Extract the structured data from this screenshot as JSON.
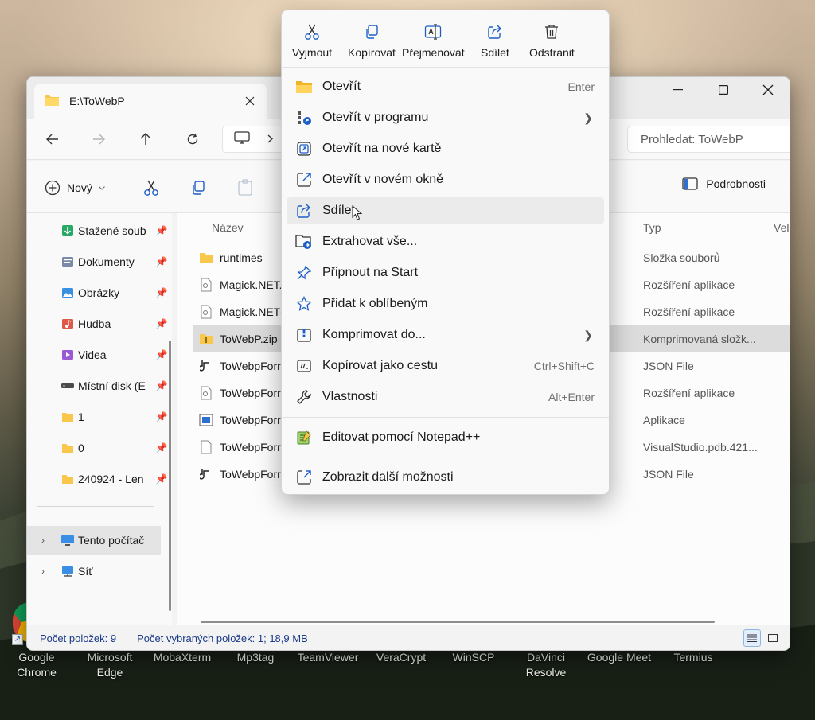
{
  "desktop": {
    "icons": [
      {
        "label": "Google\nChrome"
      },
      {
        "label": "Microsoft\nEdge"
      },
      {
        "label": "MobaXterm"
      },
      {
        "label": "Mp3tag"
      },
      {
        "label": "TeamViewer"
      },
      {
        "label": "VeraCrypt"
      },
      {
        "label": "WinSCP"
      },
      {
        "label": "DaVinci\nResolve"
      },
      {
        "label": "Google Meet"
      },
      {
        "label": "Termius"
      }
    ]
  },
  "window": {
    "tab_title": "E:\\ToWebP",
    "search_placeholder": "Prohledat: ToWebP",
    "commandbar": {
      "new_label": "Nový",
      "details_label": "Podrobnosti"
    },
    "sidebar": {
      "items": [
        {
          "label": "Stažené soub",
          "icon": "download-icon",
          "pinned": true
        },
        {
          "label": "Dokumenty",
          "icon": "documents-icon",
          "pinned": true
        },
        {
          "label": "Obrázky",
          "icon": "pictures-icon",
          "pinned": true
        },
        {
          "label": "Hudba",
          "icon": "music-icon",
          "pinned": true
        },
        {
          "label": "Videa",
          "icon": "videos-icon",
          "pinned": true
        },
        {
          "label": "Místní disk (E",
          "icon": "drive-icon",
          "pinned": true
        },
        {
          "label": "1",
          "icon": "folder-icon",
          "pinned": true
        },
        {
          "label": "0",
          "icon": "folder-icon",
          "pinned": true
        },
        {
          "label": "240924 - Len",
          "icon": "folder-icon",
          "pinned": true
        }
      ],
      "this_pc": "Tento počítač",
      "network": "Síť"
    },
    "columns": {
      "name": "Název",
      "type": "Typ",
      "size": "Veli"
    },
    "files": [
      {
        "name": "runtimes",
        "type": "Složka souborů",
        "icon": "folder-icon"
      },
      {
        "name": "Magick.NET.",
        "type": "Rozšíření aplikace",
        "icon": "dll-icon"
      },
      {
        "name": "Magick.NET-",
        "type": "Rozšíření aplikace",
        "icon": "dll-icon"
      },
      {
        "name": "ToWebP.zip",
        "type": "Komprimovaná složk...",
        "icon": "zip-folder-icon",
        "selected": true
      },
      {
        "name": "ToWebpForr",
        "type": "JSON File",
        "icon": "json-icon"
      },
      {
        "name": "ToWebpForr",
        "type": "Rozšíření aplikace",
        "icon": "dll-icon"
      },
      {
        "name": "ToWebpForr",
        "type": "Aplikace",
        "icon": "app-icon"
      },
      {
        "name": "ToWebpForr",
        "type": "VisualStudio.pdb.421...",
        "icon": "file-icon"
      },
      {
        "name": "ToWebpForr",
        "type": "JSON File",
        "icon": "json-icon"
      }
    ],
    "status": {
      "count": "Počet položek: 9",
      "selected": "Počet vybraných položek: 1; 18,9 MB"
    }
  },
  "context_menu": {
    "actions": [
      {
        "label": "Vyjmout",
        "icon": "cut-icon"
      },
      {
        "label": "Kopírovat",
        "icon": "copy-icon"
      },
      {
        "label": "Přejmenovat",
        "icon": "rename-icon"
      },
      {
        "label": "Sdílet",
        "icon": "share-icon"
      },
      {
        "label": "Odstranit",
        "icon": "trash-icon"
      }
    ],
    "items": [
      {
        "label": "Otevřít",
        "shortcut": "Enter",
        "icon": "folder-open-icon"
      },
      {
        "label": "Otevřít v programu",
        "submenu": true,
        "icon": "open-with-icon"
      },
      {
        "label": "Otevřít na nové kartě",
        "icon": "new-tab-icon"
      },
      {
        "label": "Otevřít v novém okně",
        "icon": "new-window-icon"
      },
      {
        "label": "Sdílet",
        "icon": "share-icon",
        "hover": true
      },
      {
        "label": "Extrahovat vše...",
        "icon": "extract-icon"
      },
      {
        "label": "Připnout na Start",
        "icon": "pin-icon"
      },
      {
        "label": "Přidat k oblíbeným",
        "icon": "star-icon"
      },
      {
        "label": "Komprimovat do...",
        "submenu": true,
        "icon": "compress-icon"
      },
      {
        "label": "Kopírovat jako cestu",
        "shortcut": "Ctrl+Shift+C",
        "icon": "copy-path-icon"
      },
      {
        "label": "Vlastnosti",
        "shortcut": "Alt+Enter",
        "icon": "wrench-icon"
      }
    ],
    "extra_items": [
      {
        "label": "Editovat pomocí Notepad++",
        "icon": "notepadpp-icon"
      }
    ],
    "more_options": {
      "label": "Zobrazit další možnosti",
      "icon": "more-options-icon"
    }
  }
}
